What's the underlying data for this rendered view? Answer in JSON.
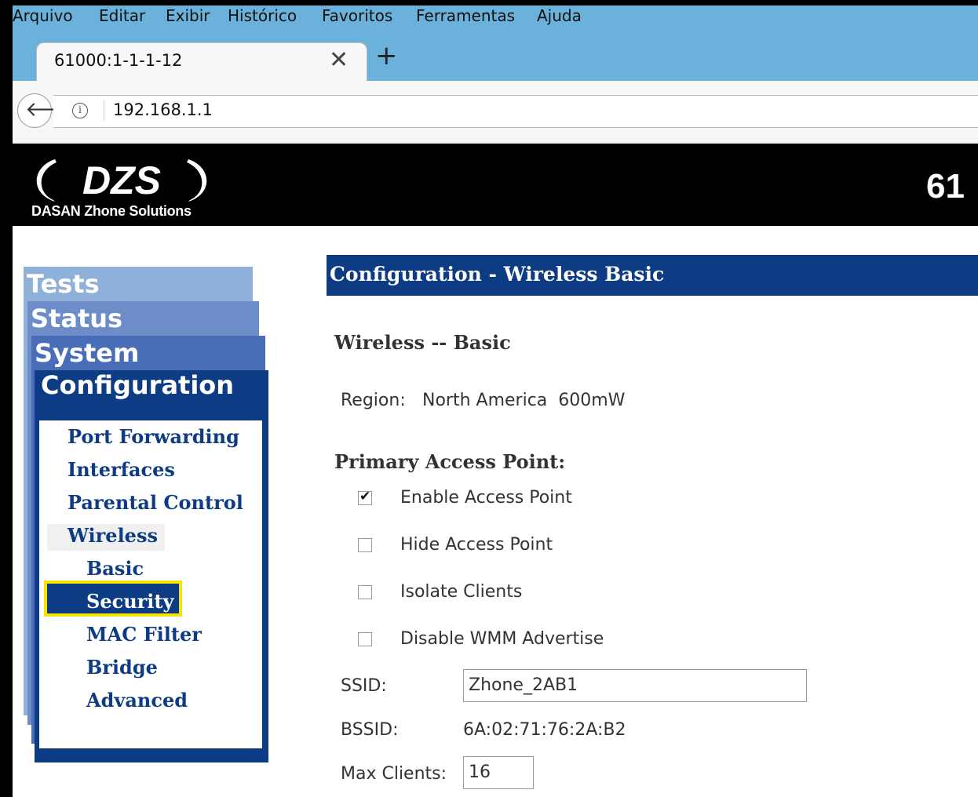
{
  "browser": {
    "menu": [
      "Arquivo",
      "Editar",
      "Exibir",
      "Histórico",
      "Favoritos",
      "Ferramentas",
      "Ajuda"
    ],
    "tab_title": "61000:1-1-1-12",
    "url": "192.168.1.1",
    "icons": {
      "close": "close-icon",
      "new_tab": "plus-icon",
      "back": "back-arrow-icon",
      "info": "info-icon"
    }
  },
  "header": {
    "logo_text": "DZS",
    "brand": "DASAN Zhone Solutions",
    "model": "61"
  },
  "nav": {
    "tabs": [
      "Tests",
      "Status",
      "System",
      "Configuration"
    ],
    "items": [
      "Port Forwarding",
      "Interfaces",
      "Parental Control",
      "Wireless"
    ],
    "subitems": [
      "Basic",
      "Security",
      "MAC Filter",
      "Bridge",
      "Advanced"
    ],
    "highlight_color": "#f5e600",
    "active_bg": "#0e3c84"
  },
  "content": {
    "header": "Configuration - Wireless Basic",
    "section": "Wireless -- Basic",
    "region_label": "Region:",
    "region_value": "North America  600mW",
    "primary_ap": "Primary Access Point:",
    "options": [
      {
        "label": "Enable Access Point",
        "checked": true
      },
      {
        "label": "Hide Access Point",
        "checked": false
      },
      {
        "label": "Isolate Clients",
        "checked": false
      },
      {
        "label": "Disable WMM Advertise",
        "checked": false
      }
    ],
    "ssid_label": "SSID:",
    "ssid_value": "Zhone_2AB1",
    "bssid_label": "BSSID:",
    "bssid_value": "6A:02:71:76:2A:B2",
    "max_clients_label": "Max Clients:",
    "max_clients_value": "16"
  }
}
